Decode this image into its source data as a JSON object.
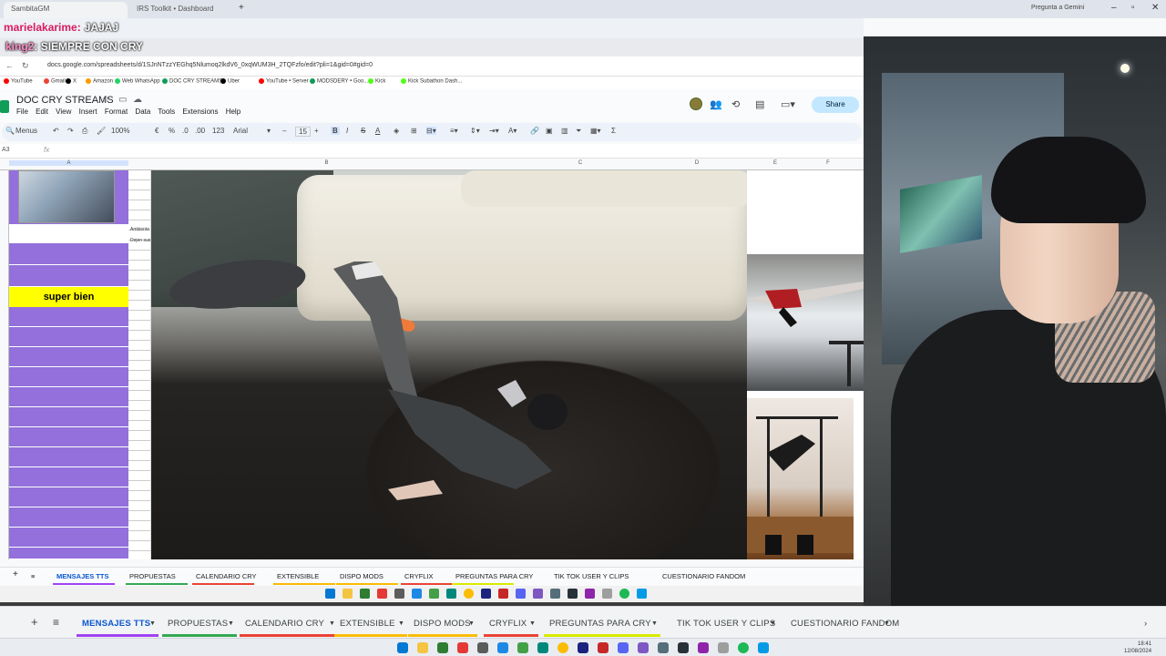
{
  "outer_browser": {
    "tabs": [
      {
        "label": "SambitaGM"
      },
      {
        "label": "IRS Toolkit • Dashboard"
      }
    ],
    "gemini_label": "Pregunta a Gemini"
  },
  "chat": {
    "line1_user": "marielakarime",
    "line1_text": "JAJAJ",
    "line2_user": "king2",
    "line2_text": "SIEMPRE CON CRY"
  },
  "inner_browser": {
    "url": "docs.google.com/spreadsheets/d/1SJnNTzzYEGhq5Nlumoq2lkdV6_0xqWUM3H_2TQFzfo/edit?pli=1&gid=0#gid=0",
    "bookmarks": [
      "YouTube",
      "Gmail",
      "X",
      "Amazon",
      "Web WhatsApp",
      "DOC CRY STREAMS",
      "Uber",
      "YouTube • Server",
      "MODSDERY • Goo...",
      "Kick",
      "Kick Subathon Dash..."
    ]
  },
  "sheets": {
    "doc_title": "DOC CRY STREAMS",
    "menus": [
      "File",
      "Edit",
      "View",
      "Insert",
      "Format",
      "Data",
      "Tools",
      "Extensions",
      "Help"
    ],
    "share_label": "Share",
    "toolbar": {
      "menus_label": "Menus",
      "zoom": "100%",
      "currency": "€",
      "percent": "%",
      "dec_down": ".0",
      "dec_up": ".00",
      "number_format": "123",
      "font": "Arial",
      "font_size": "15"
    },
    "cell_ref": "A3",
    "fx": "fx",
    "columns": [
      "A",
      "B",
      "C",
      "D",
      "E",
      "F"
    ],
    "highlight_cell": "super bien",
    "strip_labels": [
      "Ambiente",
      "Dejen sus"
    ],
    "sheet_tabs": [
      {
        "label": "MENSAJES TTS",
        "color": "#a142f4",
        "active": true
      },
      {
        "label": "PROPUESTAS",
        "color": "#34a853"
      },
      {
        "label": "CALENDARIO CRY",
        "color": "#ea4335"
      },
      {
        "label": "EXTENSIBLE",
        "color": "#fbbc04"
      },
      {
        "label": "DISPO MODS",
        "color": "#fbbc04"
      },
      {
        "label": "CRYFLIX",
        "color": "#ea4335"
      },
      {
        "label": "PREGUNTAS PARA CRY",
        "color": "#d9ea00"
      },
      {
        "label": "TIK TOK USER Y CLIPS",
        "color": ""
      },
      {
        "label": "CUESTIONARIO FANDOM",
        "color": ""
      }
    ]
  },
  "outer_sheet_tabs": [
    {
      "label": "MENSAJES TTS",
      "color": "#a142f4",
      "active": true
    },
    {
      "label": "PROPUESTAS",
      "color": "#34a853"
    },
    {
      "label": "CALENDARIO CRY",
      "color": "#ea4335"
    },
    {
      "label": "EXTENSIBLE",
      "color": "#fbbc04"
    },
    {
      "label": "DISPO MODS",
      "color": "#fbbc04"
    },
    {
      "label": "CRYFLIX",
      "color": "#ea4335"
    },
    {
      "label": "PREGUNTAS PARA CRY",
      "color": "#d9ea00"
    },
    {
      "label": "TIK TOK USER Y CLIPS",
      "color": ""
    },
    {
      "label": "CUESTIONARIO FANDOM",
      "color": ""
    }
  ],
  "clock": {
    "time": "18:41",
    "date": "12/08/2024"
  }
}
